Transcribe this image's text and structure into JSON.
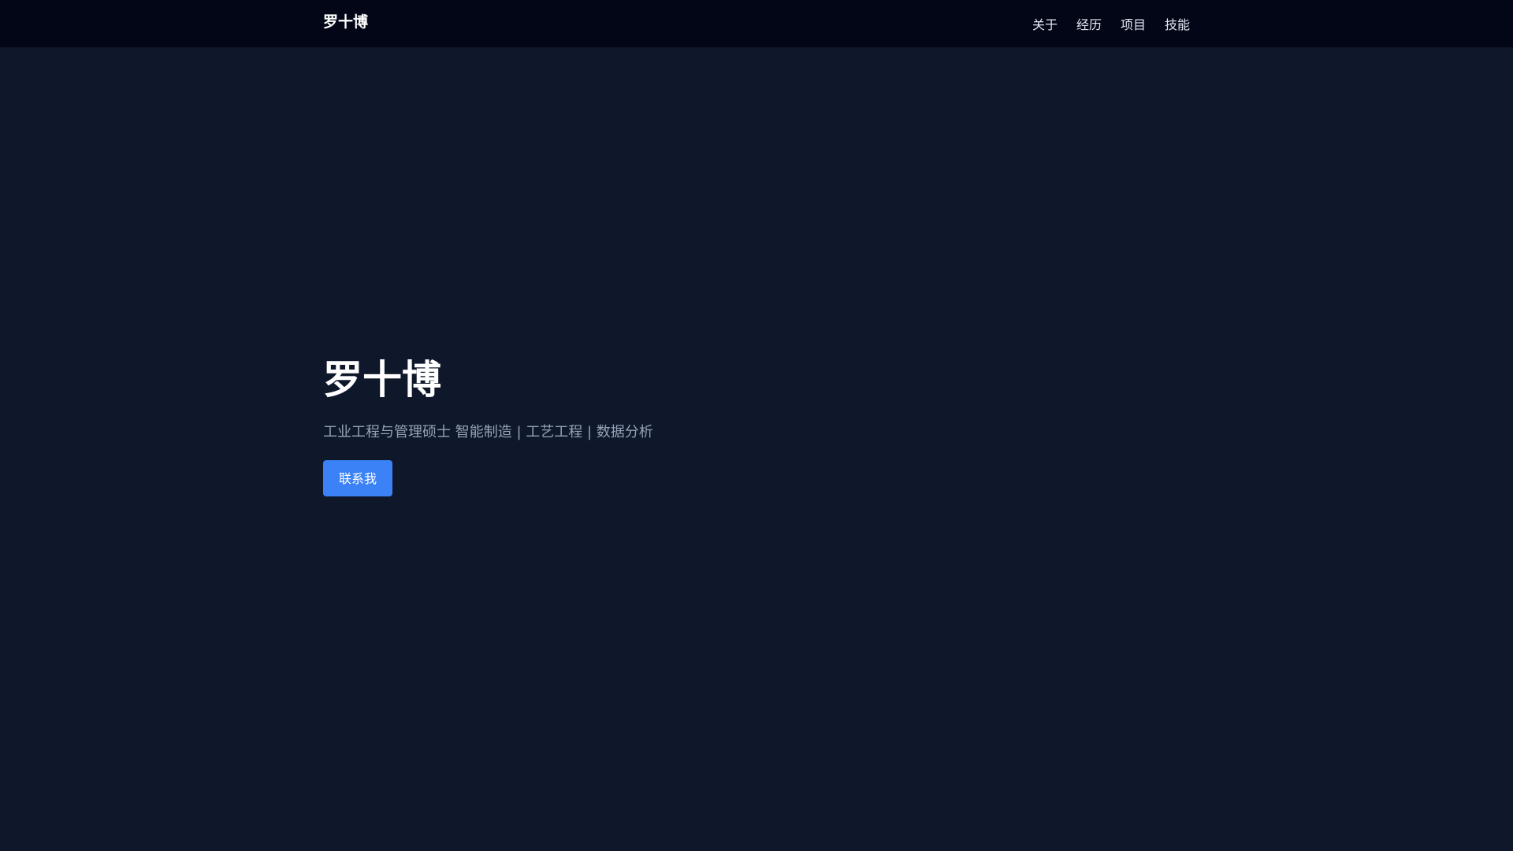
{
  "colors": {
    "background": "#0f172a",
    "navbar": "#020617",
    "primary": "#3b82f6",
    "text": "#ffffff",
    "muted": "#94a3b8"
  },
  "header": {
    "brand": "罗十博",
    "nav": [
      {
        "label": "关于"
      },
      {
        "label": "经历"
      },
      {
        "label": "项目"
      },
      {
        "label": "技能"
      }
    ]
  },
  "hero": {
    "title": "罗十博",
    "subtitle": "工业工程与管理硕士 智能制造 | 工艺工程 | 数据分析",
    "contact_button": "联系我"
  }
}
